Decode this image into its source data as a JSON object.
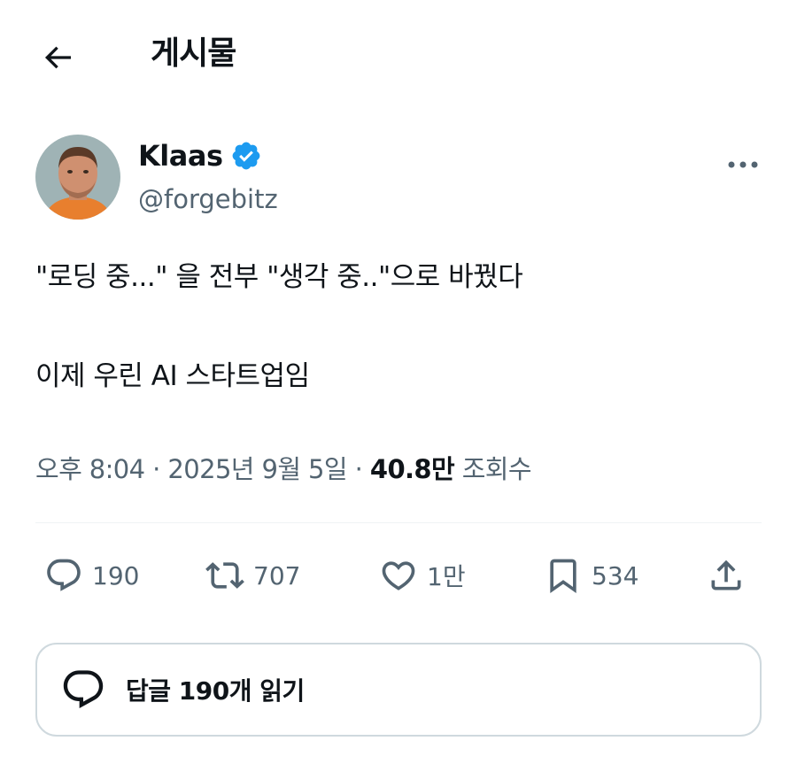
{
  "header": {
    "title": "게시물"
  },
  "author": {
    "name": "Klaas",
    "handle": "@forgebitz",
    "verified": true
  },
  "tweet": {
    "line1": "\"로딩 중...\" 을 전부 \"생각 중..\"으로 바꿨다",
    "line2": "이제 우린 AI 스타트업임"
  },
  "meta": {
    "time": "오후 8:04",
    "separator": "·",
    "date": "2025년 9월 5일",
    "views_count": "40.8만",
    "views_label": "조회수"
  },
  "actions": {
    "replies": "190",
    "reposts": "707",
    "likes": "1만",
    "bookmarks": "534"
  },
  "replies_button": {
    "label": "답글 190개 읽기"
  },
  "colors": {
    "accent": "#1d9bf0",
    "secondary_text": "#536471",
    "primary_text": "#0f1419",
    "border": "#cfd9de"
  }
}
